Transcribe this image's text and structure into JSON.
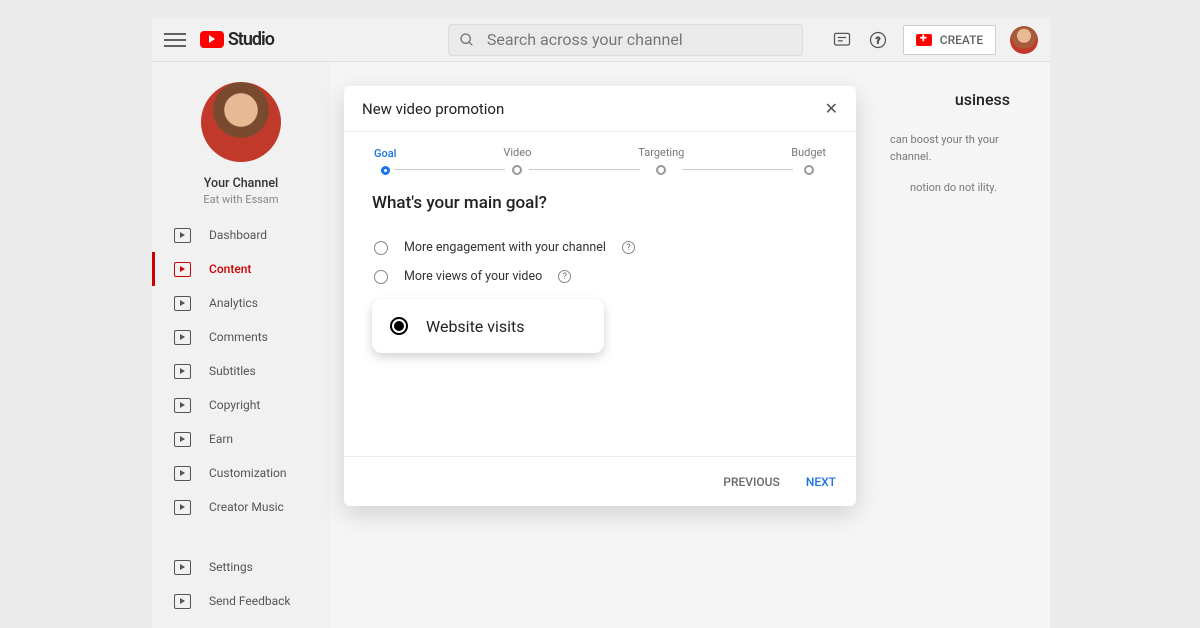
{
  "header": {
    "brand": "Studio",
    "search_placeholder": "Search across your channel",
    "create_label": "CREATE"
  },
  "sidebar": {
    "channel_title": "Your Channel",
    "channel_name": "Eat with Essam",
    "items": [
      {
        "label": "Dashboard"
      },
      {
        "label": "Content"
      },
      {
        "label": "Analytics"
      },
      {
        "label": "Comments"
      },
      {
        "label": "Subtitles"
      },
      {
        "label": "Copyright"
      },
      {
        "label": "Earn"
      },
      {
        "label": "Customization"
      },
      {
        "label": "Creator Music"
      }
    ],
    "bottom": [
      {
        "label": "Settings"
      },
      {
        "label": "Send Feedback"
      }
    ]
  },
  "modal": {
    "title": "New video promotion",
    "steps": [
      "Goal",
      "Video",
      "Targeting",
      "Budget"
    ],
    "question": "What's your main goal?",
    "options": [
      {
        "label": "More engagement with your channel"
      },
      {
        "label": "More views of your video"
      }
    ],
    "highlighted_option": "Website visits",
    "prev": "PREVIOUS",
    "next": "NEXT"
  },
  "background_page": {
    "title_fragment": "usiness",
    "note1": "can boost your th your channel.",
    "note2": "notion do not ility."
  }
}
